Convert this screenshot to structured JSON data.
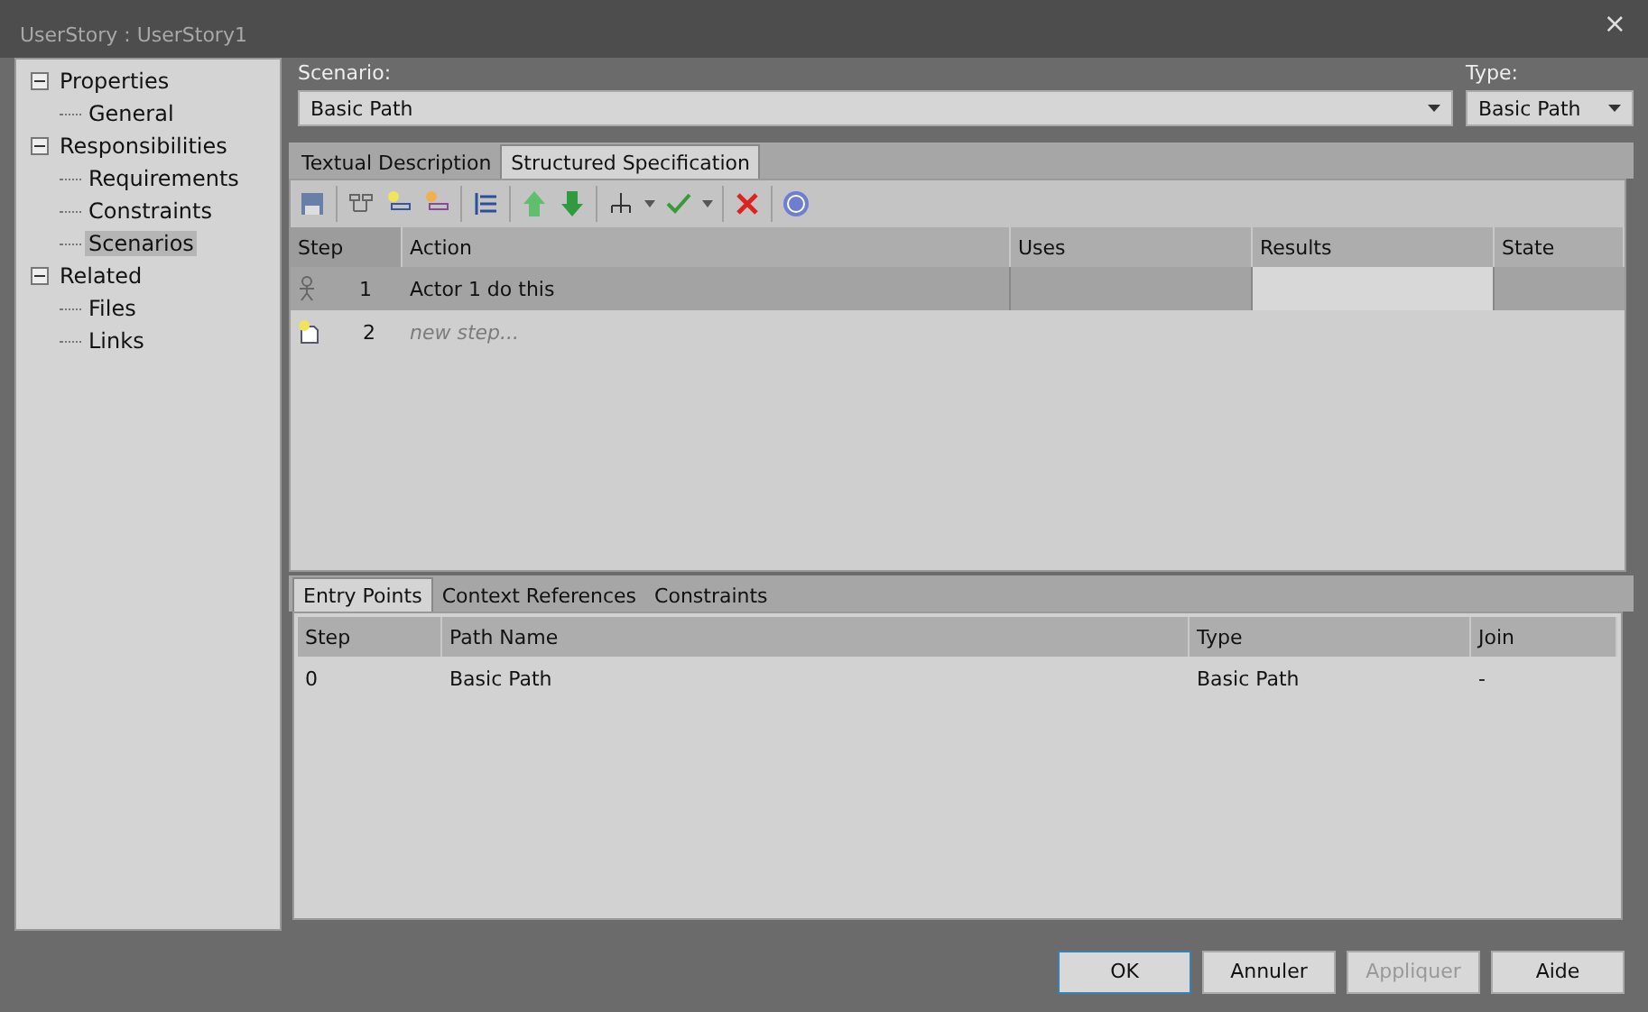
{
  "window": {
    "title": "UserStory : UserStory1",
    "close": "×"
  },
  "tree": [
    {
      "label": "Properties",
      "expanded": true,
      "selected": false,
      "children": [
        {
          "label": "General",
          "selected": false
        }
      ]
    },
    {
      "label": "Responsibilities",
      "expanded": true,
      "selected": false,
      "children": [
        {
          "label": "Requirements",
          "selected": false
        },
        {
          "label": "Constraints",
          "selected": false
        },
        {
          "label": "Scenarios",
          "selected": true
        }
      ]
    },
    {
      "label": "Related",
      "expanded": true,
      "selected": false,
      "children": [
        {
          "label": "Files",
          "selected": false
        },
        {
          "label": "Links",
          "selected": false
        }
      ]
    }
  ],
  "scenario": {
    "label": "Scenario:",
    "value": "Basic Path"
  },
  "type": {
    "label": "Type:",
    "value": "Basic Path"
  },
  "tabs": [
    {
      "label": "Textual Description",
      "selected": false
    },
    {
      "label": "Structured Specification",
      "selected": true
    }
  ],
  "steps": {
    "columns": [
      "Step",
      "Action",
      "Uses",
      "Results",
      "State"
    ],
    "rows": [
      {
        "kind": "actor",
        "step": "1",
        "action": "Actor 1 do this",
        "selected": true
      },
      {
        "kind": "new",
        "step": "2",
        "placeholder": "new step...",
        "selected": false
      }
    ]
  },
  "lower_tabs": [
    {
      "label": "Entry Points",
      "selected": true
    },
    {
      "label": "Context References",
      "selected": false
    },
    {
      "label": "Constraints",
      "selected": false
    }
  ],
  "entry_points": {
    "columns": [
      "Step",
      "Path Name",
      "Type",
      "Join"
    ],
    "rows": [
      [
        "0",
        "Basic Path",
        "Basic Path",
        "-"
      ]
    ]
  },
  "buttons": [
    {
      "label": "OK",
      "default": true,
      "disabled": false
    },
    {
      "label": "Annuler",
      "default": false,
      "disabled": false
    },
    {
      "label": "Appliquer",
      "default": false,
      "disabled": true
    },
    {
      "label": "Aide",
      "default": false,
      "disabled": false
    }
  ]
}
